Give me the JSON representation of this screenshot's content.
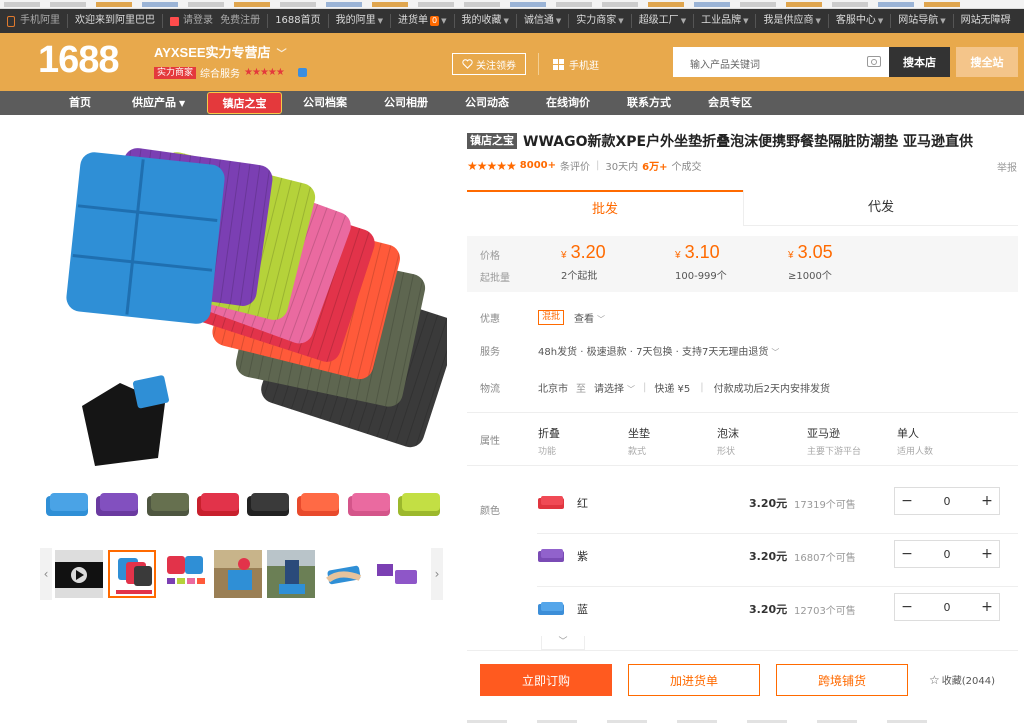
{
  "topbar": {
    "items": [
      "手机阿里",
      "欢迎来到阿里巴巴",
      "请登录",
      "免费注册",
      "1688首页",
      "我的阿里",
      "进货单",
      "我的收藏",
      "诚信通",
      "实力商家",
      "超级工厂",
      "工业品牌",
      "我是供应商",
      "客服中心",
      "网站导航",
      "网站无障碍"
    ],
    "cart_count": "0"
  },
  "header": {
    "logo": "1688",
    "shop_name": "AYXSEE实力专营店",
    "badge": "实力商家",
    "service_label": "综合服务",
    "stars": "★★★★★",
    "follow_label": "关注领券",
    "mobile_label": "手机逛",
    "search_placeholder": "输入产品关键词",
    "search_shop_label": "搜本店",
    "search_all_label": "搜全站"
  },
  "nav": {
    "items": [
      "首页",
      "供应产品",
      "镇店之宝",
      "公司档案",
      "公司相册",
      "公司动态",
      "在线询价",
      "联系方式",
      "会员专区"
    ]
  },
  "product": {
    "tag": "镇店之宝",
    "title": "WWAGO新款XPE户外坐垫折叠泡沫便携野餐垫隔脏防潮垫 亚马逊直供",
    "rating_stars": "★★★★★",
    "reviews": "8000+",
    "reviews_label": "条评价",
    "sales_prefix": "30天内",
    "sales": "6万+",
    "sales_suffix": "个成交",
    "report": "举报"
  },
  "tabs": [
    "批发",
    "代发"
  ],
  "pricing": {
    "price_label": "价格",
    "moq_label": "起批量",
    "currency": "¥",
    "tiers": [
      {
        "price": "3.20",
        "moq": "2个起批"
      },
      {
        "price": "3.10",
        "moq": "100-999个"
      },
      {
        "price": "3.05",
        "moq": "≥1000个"
      }
    ]
  },
  "info": {
    "promo_label": "优惠",
    "promo_badge": "混批",
    "promo_link": "查看",
    "service_label": "服务",
    "service_text": "48h发货 · 极速退款 · 7天包换 · 支持7天无理由退货",
    "logistics_label": "物流",
    "from": "北京市",
    "to_label": "至",
    "to": "请选择",
    "shipping": "快递 ¥5",
    "delivery": "付款成功后2天内安排发货"
  },
  "attributes": {
    "label": "属性",
    "items": [
      {
        "value": "折叠",
        "name": "功能"
      },
      {
        "value": "坐垫",
        "name": "款式"
      },
      {
        "value": "泡沫",
        "name": "形状"
      },
      {
        "value": "亚马逊",
        "name": "主要下游平台"
      },
      {
        "value": "单人",
        "name": "适用人数"
      }
    ]
  },
  "skus": {
    "label": "颜色",
    "items": [
      {
        "name": "红",
        "price": "3.20元",
        "stock": "17319个可售",
        "qty": "0",
        "color": "#e0353f"
      },
      {
        "name": "紫",
        "price": "3.20元",
        "stock": "16807个可售",
        "qty": "0",
        "color": "#7a4bb5"
      },
      {
        "name": "蓝",
        "price": "3.20元",
        "stock": "12703个可售",
        "qty": "0",
        "color": "#3c8ed8"
      }
    ]
  },
  "actions": {
    "buy": "立即订购",
    "cart": "加进货单",
    "distribute": "跨境铺货",
    "favorite": "收藏(2044)"
  },
  "colors": {
    "accent": "#ff6a00",
    "header_bg": "#e8a94c",
    "nav_bg": "#5c5c5c",
    "buy_bg": "#ff5a1f"
  }
}
